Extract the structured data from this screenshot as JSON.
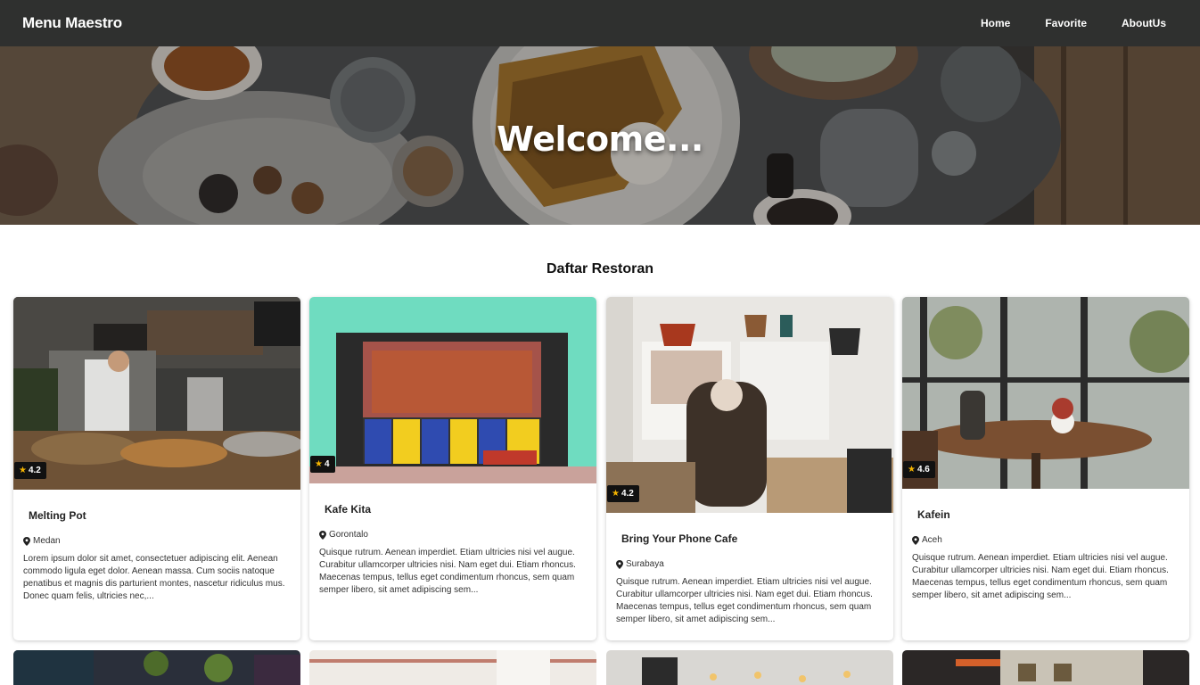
{
  "navbar": {
    "brand": "Menu Maestro",
    "links": [
      "Home",
      "Favorite",
      "AboutUs"
    ]
  },
  "hero": {
    "title": "Welcome..."
  },
  "section": {
    "title": "Daftar Restoran"
  },
  "restaurants": [
    {
      "name": "Melting Pot",
      "city": "Medan",
      "rating": "4.2",
      "description": "Lorem ipsum dolor sit amet, consectetuer adipiscing elit. Aenean commodo ligula eget dolor. Aenean massa. Cum sociis natoque penatibus et magnis dis parturient montes, nascetur ridiculus mus. Donec quam felis, ultricies nec,..."
    },
    {
      "name": "Kafe Kita",
      "city": "Gorontalo",
      "rating": "4",
      "description": "Quisque rutrum. Aenean imperdiet. Etiam ultricies nisi vel augue. Curabitur ullamcorper ultricies nisi. Nam eget dui. Etiam rhoncus. Maecenas tempus, tellus eget condimentum rhoncus, sem quam semper libero, sit amet adipiscing sem..."
    },
    {
      "name": "Bring Your Phone Cafe",
      "city": "Surabaya",
      "rating": "4.2",
      "description": "Quisque rutrum. Aenean imperdiet. Etiam ultricies nisi vel augue. Curabitur ullamcorper ultricies nisi. Nam eget dui. Etiam rhoncus. Maecenas tempus, tellus eget condimentum rhoncus, sem quam semper libero, sit amet adipiscing sem..."
    },
    {
      "name": "Kafein",
      "city": "Aceh",
      "rating": "4.6",
      "description": "Quisque rutrum. Aenean imperdiet. Etiam ultricies nisi vel augue. Curabitur ullamcorper ultricies nisi. Nam eget dui. Etiam rhoncus. Maecenas tempus, tellus eget condimentum rhoncus, sem quam semper libero, sit amet adipiscing sem..."
    }
  ],
  "icons": {
    "rating": "star-icon",
    "location": "map-pin-icon"
  },
  "colors": {
    "navbar": "#2f302f",
    "star": "#f5b400",
    "rating_badge": "#111111"
  }
}
